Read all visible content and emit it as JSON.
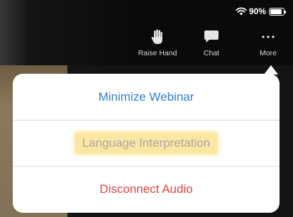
{
  "status_bar": {
    "battery_text": "90%",
    "battery_level": 0.9,
    "icons": [
      "wifi-icon",
      "battery-icon"
    ]
  },
  "toolbar": {
    "raise_hand": {
      "label": "Raise Hand",
      "icon": "hand-icon"
    },
    "chat": {
      "label": "Chat",
      "icon": "chat-bubble-icon"
    },
    "more": {
      "label": "More",
      "icon": "more-dots-icon"
    }
  },
  "menu": {
    "items": [
      {
        "label": "Minimize Webinar",
        "color": "#2f7fd6"
      },
      {
        "label": "Language Interpretation",
        "color": "#a8a8a8",
        "highlight": "#fbe7a2",
        "enabled": false
      },
      {
        "label": "Disconnect Audio",
        "color": "#e0453e"
      }
    ]
  }
}
